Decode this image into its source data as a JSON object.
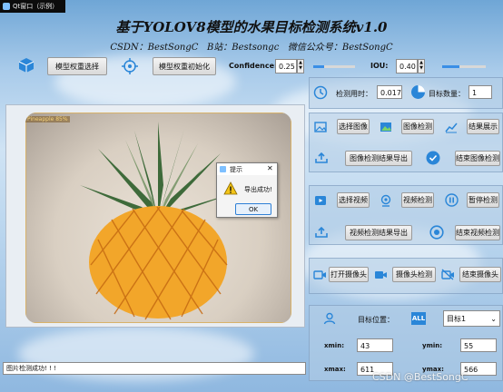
{
  "window": {
    "title": "Qt窗口（示例）"
  },
  "header": {
    "title": "基于YOLOV8模型的水果目标检测系统v1.0",
    "subtitle": "CSDN：BestSongC   B站：Bestsongc   微信公众号：BestSongC"
  },
  "toolbar": {
    "model_select": "模型权重选择",
    "model_init": "模型权重初始化",
    "confidence_label": "Confidence:",
    "confidence_value": "0.25",
    "confidence_fraction": 0.25,
    "iou_label": "IOU:",
    "iou_value": "0.40",
    "iou_fraction": 0.4
  },
  "image_panel": {
    "detection_label": "Pineapple 85%"
  },
  "dialog": {
    "title": "提示",
    "message": "导出成功!",
    "ok": "OK",
    "close": "✕"
  },
  "status": {
    "text": "图片检测成功! ! !"
  },
  "stats": {
    "time_label": "检测用时：",
    "time_value": "0.017",
    "count_label": "目标数量：",
    "count_value": "1"
  },
  "image_section": {
    "select": "选择图像",
    "detect": "图像检测",
    "show": "结果展示",
    "export": "图像检测结果导出",
    "stop": "结束图像检测"
  },
  "video_section": {
    "select": "选择视频",
    "detect": "视频检测",
    "pause": "暂停检测",
    "export": "视频检测结果导出",
    "stop": "结束视频检测"
  },
  "camera_section": {
    "open": "打开摄像头",
    "detect": "摄像头检测",
    "stop": "结束摄像头"
  },
  "target": {
    "position_label": "目标位置：",
    "all_label": "ALL",
    "selected": "目标1",
    "xmin_label": "xmin:",
    "xmin": "43",
    "ymin_label": "ymin:",
    "ymin": "55",
    "xmax_label": "xmax:",
    "xmax": "611",
    "ymax_label": "ymax:",
    "ymax": "566"
  },
  "watermark": "CSDN @BestSongC",
  "colors": {
    "accent": "#2e7fd6",
    "title_bg": "#0c0c0c",
    "pineapple": "#f2a62a",
    "leaves": "#3e6a3a"
  }
}
